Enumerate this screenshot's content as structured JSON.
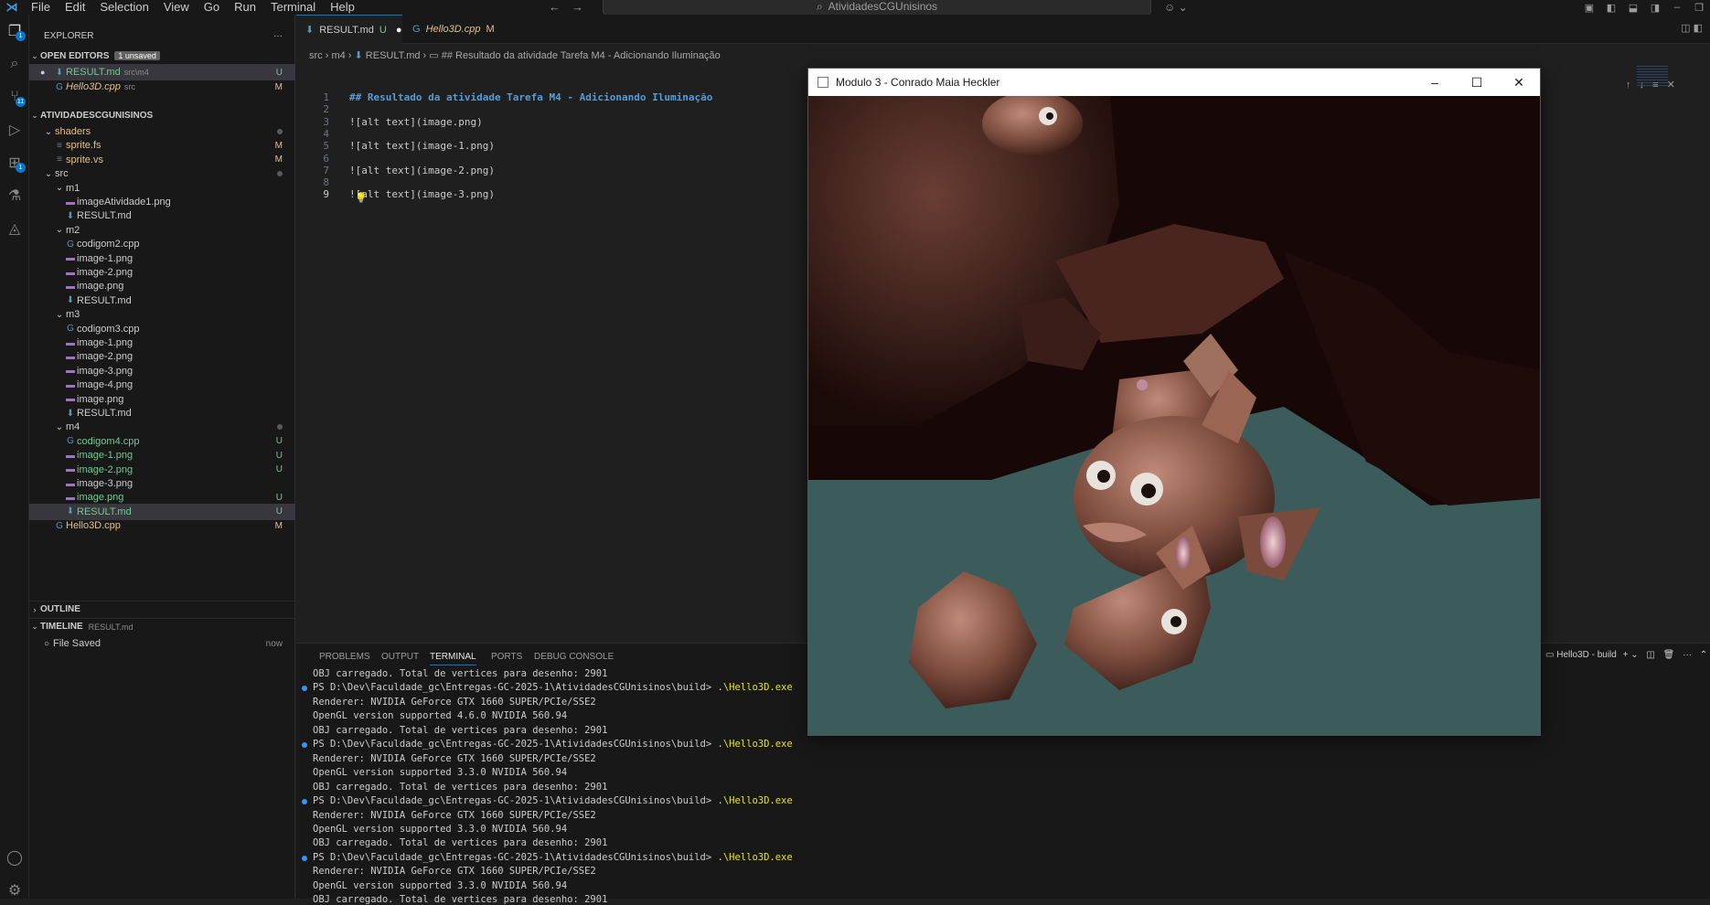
{
  "menu": [
    "File",
    "Edit",
    "Selection",
    "View",
    "Go",
    "Run",
    "Terminal",
    "Help"
  ],
  "search": {
    "text": "AtividadesCGUnisinos"
  },
  "sidebar": {
    "title": "EXPLORER",
    "open_editors": {
      "label": "OPEN EDITORS",
      "badge": "1 unsaved"
    },
    "open_files": [
      {
        "name": "RESULT.md",
        "path": "src\\m4",
        "status": "U"
      },
      {
        "name": "Hello3D.cpp",
        "path": "src",
        "status": "M"
      }
    ],
    "root": "ATIVIDADESCGUNISINOS",
    "tree": [
      {
        "name": "shaders",
        "type": "folder",
        "indent": 1,
        "status": "dot"
      },
      {
        "name": "sprite.fs",
        "type": "file",
        "indent": 2,
        "status": "M"
      },
      {
        "name": "sprite.vs",
        "type": "file",
        "indent": 2,
        "status": "M"
      },
      {
        "name": "src",
        "type": "folder",
        "indent": 1,
        "status": "dot"
      },
      {
        "name": "m1",
        "type": "folder",
        "indent": 2,
        "status": ""
      },
      {
        "name": "imageAtividade1.png",
        "type": "image",
        "indent": 3,
        "status": ""
      },
      {
        "name": "RESULT.md",
        "type": "md",
        "indent": 3,
        "status": ""
      },
      {
        "name": "m2",
        "type": "folder",
        "indent": 2,
        "status": ""
      },
      {
        "name": "codigom2.cpp",
        "type": "cpp",
        "indent": 3,
        "status": ""
      },
      {
        "name": "image-1.png",
        "type": "image",
        "indent": 3,
        "status": ""
      },
      {
        "name": "image-2.png",
        "type": "image",
        "indent": 3,
        "status": ""
      },
      {
        "name": "image.png",
        "type": "image",
        "indent": 3,
        "status": ""
      },
      {
        "name": "RESULT.md",
        "type": "md",
        "indent": 3,
        "status": ""
      },
      {
        "name": "m3",
        "type": "folder",
        "indent": 2,
        "status": ""
      },
      {
        "name": "codigom3.cpp",
        "type": "cpp",
        "indent": 3,
        "status": ""
      },
      {
        "name": "image-1.png",
        "type": "image",
        "indent": 3,
        "status": ""
      },
      {
        "name": "image-2.png",
        "type": "image",
        "indent": 3,
        "status": ""
      },
      {
        "name": "image-3.png",
        "type": "image",
        "indent": 3,
        "status": ""
      },
      {
        "name": "image-4.png",
        "type": "image",
        "indent": 3,
        "status": ""
      },
      {
        "name": "image.png",
        "type": "image",
        "indent": 3,
        "status": ""
      },
      {
        "name": "RESULT.md",
        "type": "md",
        "indent": 3,
        "status": ""
      },
      {
        "name": "m4",
        "type": "folder",
        "indent": 2,
        "status": "dot"
      },
      {
        "name": "codigom4.cpp",
        "type": "cpp",
        "indent": 3,
        "status": "U"
      },
      {
        "name": "image-1.png",
        "type": "image",
        "indent": 3,
        "status": "U"
      },
      {
        "name": "image-2.png",
        "type": "image",
        "indent": 3,
        "status": "U"
      },
      {
        "name": "image-3.png",
        "type": "image",
        "indent": 3,
        "status": ""
      },
      {
        "name": "image.png",
        "type": "image",
        "indent": 3,
        "status": "U"
      },
      {
        "name": "RESULT.md",
        "type": "md",
        "indent": 3,
        "status": "U",
        "selected": true
      },
      {
        "name": "Hello3D.cpp",
        "type": "cpp",
        "indent": 2,
        "status": "M"
      }
    ],
    "outline": "OUTLINE",
    "timeline": {
      "label": "TIMELINE",
      "file": "RESULT.md",
      "entry": "File Saved",
      "when": "now"
    }
  },
  "tabs": [
    {
      "name": "RESULT.md",
      "status": "U",
      "active": true
    },
    {
      "name": "Hello3D.cpp",
      "status": "M",
      "active": false
    }
  ],
  "breadcrumb": [
    "src",
    "m4",
    "RESULT.md",
    "## Resultado da atividade Tarefa M4 - Adicionando Iluminação"
  ],
  "code": [
    "## Resultado da atividade Tarefa M4 - Adicionando Iluminação",
    "",
    "![alt text](image.png)",
    "",
    "![alt text](image-1.png)",
    "",
    "![alt text](image-2.png)",
    "",
    "![alt text](image-3.png)"
  ],
  "panel": {
    "tabs": [
      "PROBLEMS",
      "OUTPUT",
      "TERMINAL",
      "PORTS",
      "DEBUG CONSOLE"
    ],
    "active": "TERMINAL",
    "task": "Hello3D - build",
    "terminal": [
      {
        "text": "OBJ carregado. Total de vertices para desenho: 2901"
      },
      {
        "prompt": "PS D:\\Dev\\Faculdade_gc\\Entregas-GC-2025-1\\AtividadesCGUnisinos\\build> ",
        "cmd": ".\\Hello3D.exe"
      },
      {
        "text": "Renderer: NVIDIA GeForce GTX 1660 SUPER/PCIe/SSE2"
      },
      {
        "text": "OpenGL version supported 4.6.0 NVIDIA 560.94"
      },
      {
        "text": "OBJ carregado. Total de vertices para desenho: 2901"
      },
      {
        "prompt": "PS D:\\Dev\\Faculdade_gc\\Entregas-GC-2025-1\\AtividadesCGUnisinos\\build> ",
        "cmd": ".\\Hello3D.exe"
      },
      {
        "text": "Renderer: NVIDIA GeForce GTX 1660 SUPER/PCIe/SSE2"
      },
      {
        "text": "OpenGL version supported 3.3.0 NVIDIA 560.94"
      },
      {
        "text": "OBJ carregado. Total de vertices para desenho: 2901"
      },
      {
        "prompt": "PS D:\\Dev\\Faculdade_gc\\Entregas-GC-2025-1\\AtividadesCGUnisinos\\build> ",
        "cmd": ".\\Hello3D.exe"
      },
      {
        "text": "Renderer: NVIDIA GeForce GTX 1660 SUPER/PCIe/SSE2"
      },
      {
        "text": "OpenGL version supported 3.3.0 NVIDIA 560.94"
      },
      {
        "text": "OBJ carregado. Total de vertices para desenho: 2901"
      },
      {
        "prompt": "PS D:\\Dev\\Faculdade_gc\\Entregas-GC-2025-1\\AtividadesCGUnisinos\\build> ",
        "cmd": ".\\Hello3D.exe"
      },
      {
        "text": "Renderer: NVIDIA GeForce GTX 1660 SUPER/PCIe/SSE2"
      },
      {
        "text": "OpenGL version supported 3.3.0 NVIDIA 560.94"
      },
      {
        "text": "OBJ carregado. Total de vertices para desenho: 2901"
      }
    ]
  },
  "gl_window": {
    "title": "Modulo 3 - Conrado Maia Heckler"
  },
  "colors": {
    "accent": "#0078d4",
    "modified": "#e2c08d",
    "untracked": "#73c991"
  }
}
